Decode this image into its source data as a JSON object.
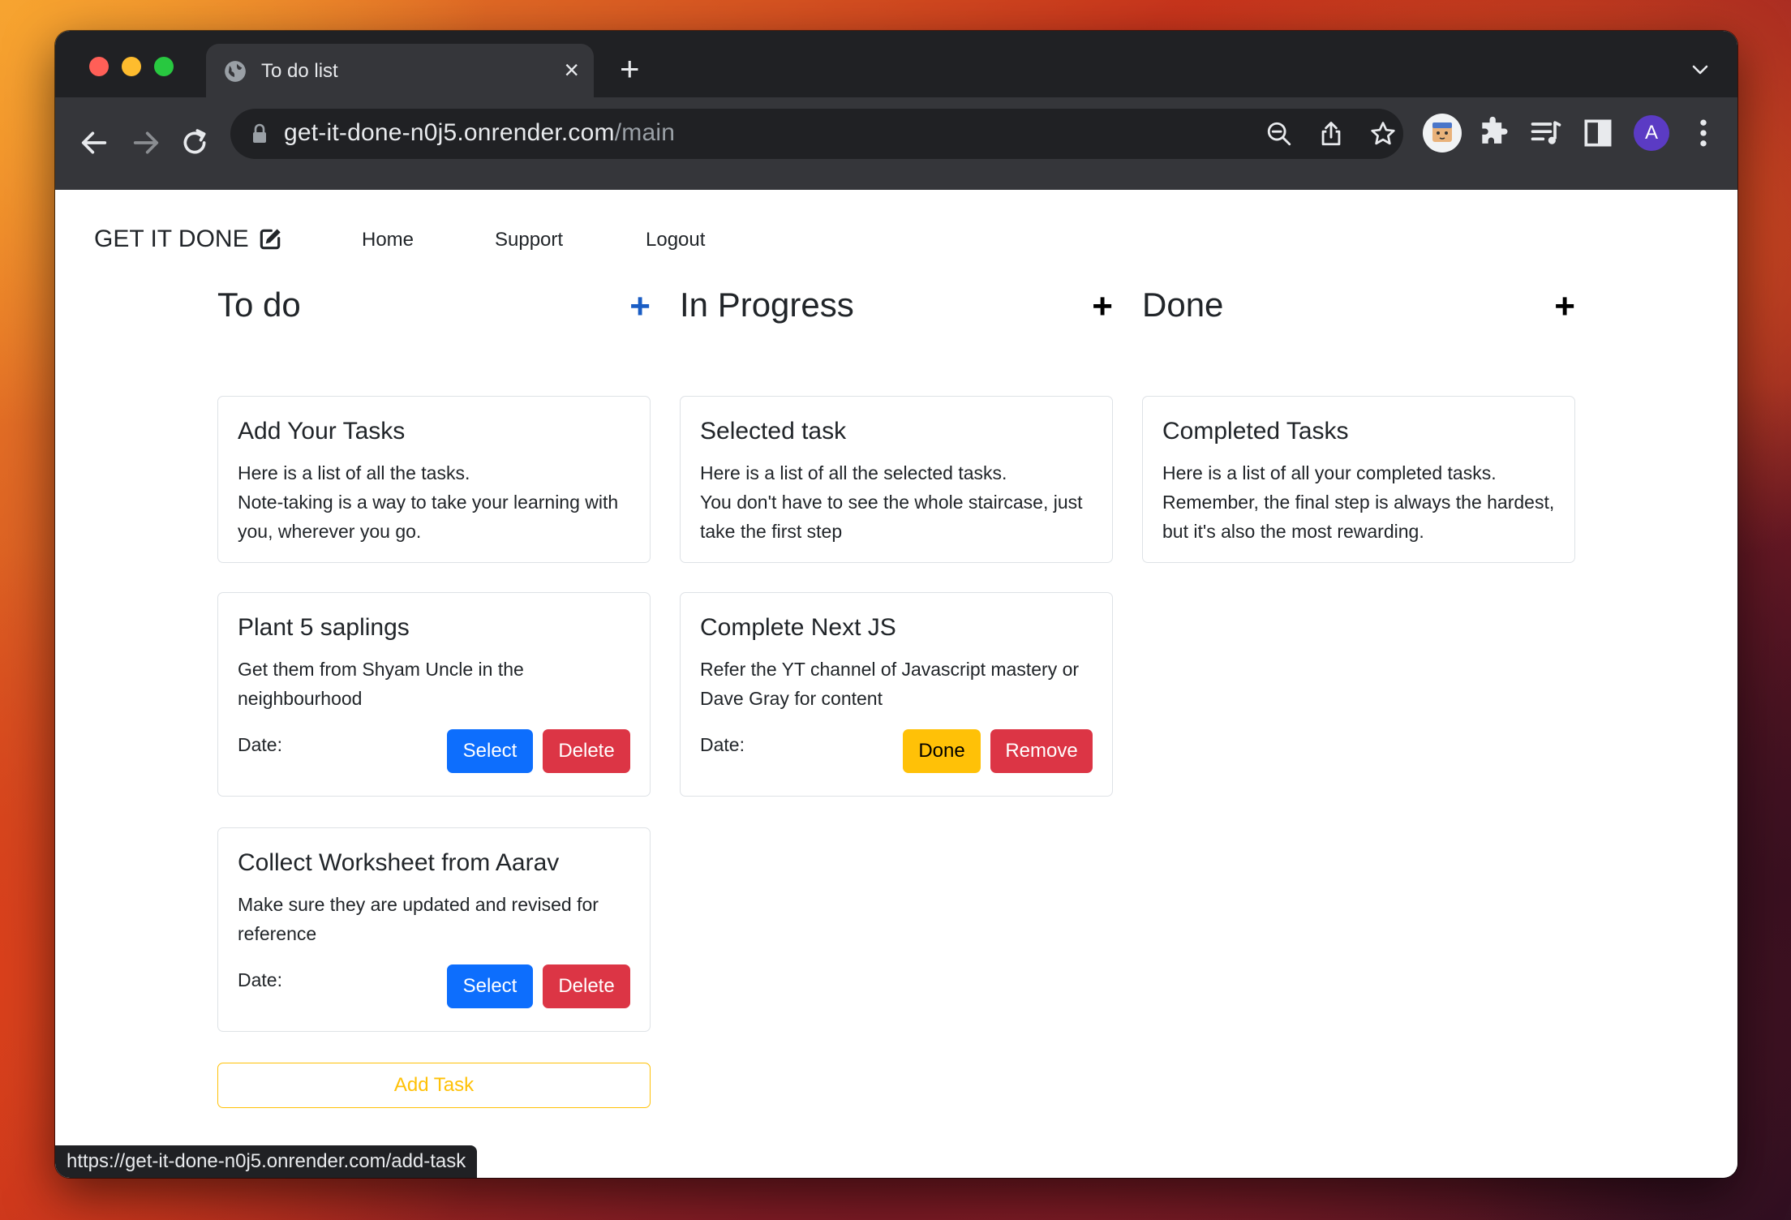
{
  "browser": {
    "tab_title": "To do list",
    "url_host": "get-it-done-n0j5.onrender.com",
    "url_path": "/main",
    "profile_initial": "A",
    "status_url": "https://get-it-done-n0j5.onrender.com/add-task"
  },
  "nav": {
    "brand": "GET IT DONE",
    "links": [
      "Home",
      "Support",
      "Logout"
    ]
  },
  "columns": [
    {
      "title": "To do",
      "plus": "+",
      "plus_color": "#0d6efd",
      "intro": {
        "title": "Add Your Tasks",
        "text": "Here is a list of all the tasks.\nNote-taking is a way to take your learning with you, wherever you go."
      },
      "tasks": [
        {
          "title": "Plant 5 saplings",
          "text": "Get them from Shyam Uncle in the neighbourhood",
          "date": "Date:",
          "btn1": "Select",
          "btn2": "Delete"
        },
        {
          "title": "Collect Worksheet from Aarav",
          "text": "Make sure they are updated and revised for reference",
          "date": "Date:",
          "btn1": "Select",
          "btn2": "Delete"
        }
      ],
      "add_task": "Add Task"
    },
    {
      "title": "In Progress",
      "plus": "+",
      "plus_color": "#000000",
      "intro": {
        "title": "Selected task",
        "text": "Here is a list of all the selected tasks.\nYou don't have to see the whole staircase, just take the first step"
      },
      "tasks": [
        {
          "title": "Complete Next JS",
          "text": "Refer the YT channel of Javascript mastery or Dave Gray for content",
          "date": "Date:",
          "btn1": "Done",
          "btn2": "Remove"
        }
      ]
    },
    {
      "title": "Done",
      "plus": "+",
      "plus_color": "#000000",
      "intro": {
        "title": "Completed Tasks",
        "text": "Here is a list of all your completed tasks.\nRemember, the final step is always the hardest, but it's also the most rewarding."
      },
      "tasks": []
    }
  ],
  "colors": {
    "primary": "#0d6efd",
    "danger": "#dc3545",
    "warning": "#ffc107"
  }
}
